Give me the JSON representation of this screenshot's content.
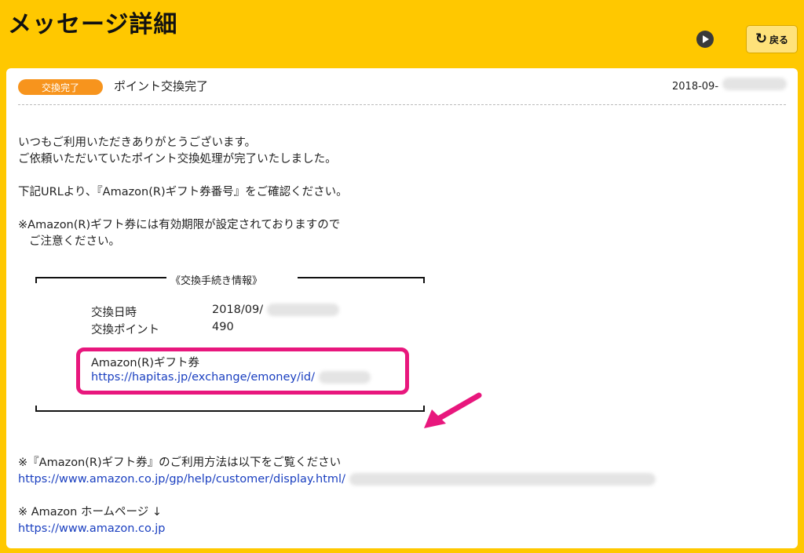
{
  "header": {
    "title": "メッセージ詳細",
    "back_label": "戻る"
  },
  "message": {
    "badge": "交換完了",
    "subject": "ポイント交換完了",
    "date": "2018-09-",
    "lines": {
      "l1": "いつもご利用いただきありがとうございます。",
      "l2": "ご依頼いただいていたポイント交換処理が完了いたしました。",
      "l3": "下記URLより、『Amazon(R)ギフト券番号』をご確認ください。",
      "l4": "※Amazon(R)ギフト券には有効期限が設定されておりますので",
      "l5": "ご注意ください。"
    },
    "info": {
      "title": "《交換手続き情報》",
      "date_label": "交換日時",
      "date_value": "2018/09/",
      "points_label": "交換ポイント",
      "points_value": "490",
      "gift_label": "Amazon(R)ギフト券",
      "gift_url": "https://hapitas.jp/exchange/emoney/id/"
    },
    "usage_note": "※『Amazon(R)ギフト券』のご利用方法は以下をご覧ください",
    "usage_url": "https://www.amazon.co.jp/gp/help/customer/display.html/",
    "home_note": "※ Amazon ホームページ ↓",
    "home_url": "https://www.amazon.co.jp"
  },
  "colors": {
    "background": "#ffc800",
    "badge": "#f7941d",
    "highlight": "#e8177d",
    "link": "#1a3fc0"
  }
}
